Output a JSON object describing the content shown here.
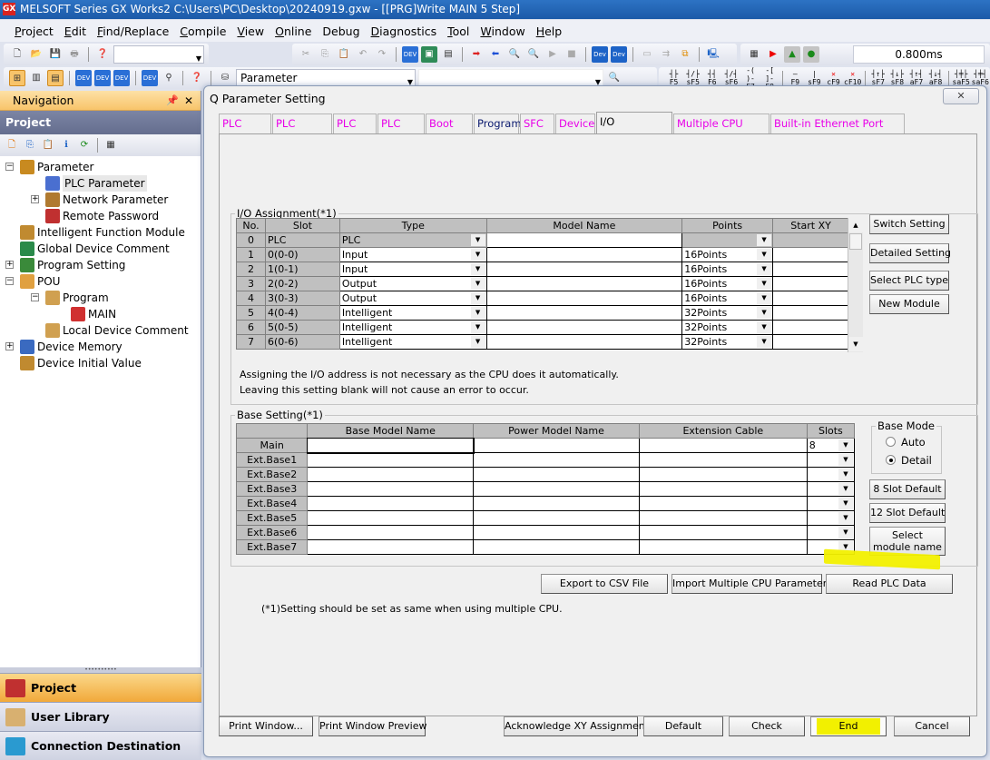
{
  "window": {
    "title": "MELSOFT Series GX Works2 C:\\Users\\PC\\Desktop\\20240919.gxw - [[PRG]Write MAIN 5 Step]",
    "app_icon": "gx-works-icon"
  },
  "menu": [
    {
      "label": "Project",
      "u": "P",
      "rest": "roject"
    },
    {
      "label": "Edit",
      "u": "E",
      "rest": "dit"
    },
    {
      "label": "Find/Replace",
      "u": "F",
      "rest": "ind/Replace"
    },
    {
      "label": "Compile",
      "u": "C",
      "rest": "ompile"
    },
    {
      "label": "View",
      "u": "V",
      "rest": "iew"
    },
    {
      "label": "Online",
      "u": "O",
      "rest": "nline"
    },
    {
      "label": "Debug",
      "u": "",
      "rest": "Debug"
    },
    {
      "label": "Diagnostics",
      "u": "D",
      "rest": "iagnostics"
    },
    {
      "label": "Tool",
      "u": "T",
      "rest": "ool"
    },
    {
      "label": "Window",
      "u": "W",
      "rest": "indow"
    },
    {
      "label": "Help",
      "u": "H",
      "rest": "elp"
    }
  ],
  "toolbar": {
    "scan_time": "0.800ms",
    "navigation_combo": "Parameter",
    "ladder_tools": [
      {
        "sym": "┤├",
        "key": "F5"
      },
      {
        "sym": "┤/├",
        "key": "sF5"
      },
      {
        "sym": "┤┤",
        "key": "F6"
      },
      {
        "sym": "┤/┤",
        "key": "sF6"
      },
      {
        "sym": "-( )-",
        "key": "F7"
      },
      {
        "sym": "-[ ]-",
        "key": "F8"
      },
      {
        "sym": "—",
        "key": "F9"
      },
      {
        "sym": "|",
        "key": "sF9"
      },
      {
        "sym": "✕",
        "key": "cF9"
      },
      {
        "sym": "✕",
        "key": "cF10"
      },
      {
        "sym": "┤↑├",
        "key": "sF7"
      },
      {
        "sym": "┤↓├",
        "key": "sF8"
      },
      {
        "sym": "┤↑┤",
        "key": "aF7"
      },
      {
        "sym": "┤↓┤",
        "key": "aF8"
      },
      {
        "sym": "┤╪├",
        "key": "saF5"
      },
      {
        "sym": "┤╪┤",
        "key": "saF6"
      }
    ]
  },
  "navigation": {
    "title": "Navigation",
    "section": "Project",
    "tree": [
      {
        "label": "Parameter",
        "level": 0,
        "expander": "-",
        "icon": "parameter-icon"
      },
      {
        "label": "PLC Parameter",
        "level": 1,
        "expander": "",
        "icon": "plc-parameter-icon",
        "selected": true
      },
      {
        "label": "Network Parameter",
        "level": 1,
        "expander": "+",
        "icon": "network-parameter-icon"
      },
      {
        "label": "Remote Password",
        "level": 1,
        "expander": "",
        "icon": "remote-password-icon"
      },
      {
        "label": "Intelligent Function Module",
        "level": 0,
        "expander": "",
        "icon": "intelligent-module-icon"
      },
      {
        "label": "Global Device Comment",
        "level": 0,
        "expander": "",
        "icon": "global-comment-icon"
      },
      {
        "label": "Program Setting",
        "level": 0,
        "expander": "+",
        "icon": "program-setting-icon"
      },
      {
        "label": "POU",
        "level": 0,
        "expander": "-",
        "icon": "pou-icon"
      },
      {
        "label": "Program",
        "level": 1,
        "expander": "-",
        "icon": "program-folder-icon"
      },
      {
        "label": "MAIN",
        "level": 2,
        "expander": "",
        "icon": "ladder-program-icon"
      },
      {
        "label": "Local Device Comment",
        "level": 1,
        "expander": "",
        "icon": "local-comment-icon"
      },
      {
        "label": "Device Memory",
        "level": 0,
        "expander": "+",
        "icon": "device-memory-icon"
      },
      {
        "label": "Device Initial Value",
        "level": 0,
        "expander": "",
        "icon": "device-initial-icon"
      }
    ],
    "bottom_tabs": [
      {
        "label": "Project",
        "active": true
      },
      {
        "label": "User Library",
        "active": false
      },
      {
        "label": "Connection Destination",
        "active": false
      }
    ]
  },
  "dialog": {
    "title": "Q Parameter Setting",
    "tabs": [
      {
        "label": "PLC Name",
        "style": "pink"
      },
      {
        "label": "PLC System",
        "style": "pink"
      },
      {
        "label": "PLC File",
        "style": "pink"
      },
      {
        "label": "PLC RAS",
        "style": "pink"
      },
      {
        "label": "Boot File",
        "style": "pink"
      },
      {
        "label": "Program",
        "style": "dark"
      },
      {
        "label": "SFC",
        "style": "pink"
      },
      {
        "label": "Device",
        "style": "pink"
      },
      {
        "label": "I/O Assignment",
        "style": "active"
      },
      {
        "label": "Multiple CPU Setting",
        "style": "pink"
      },
      {
        "label": "Built-in Ethernet Port Setting",
        "style": "pink"
      }
    ],
    "io": {
      "legend": "I/O Assignment(*1)",
      "columns": [
        "No.",
        "Slot",
        "Type",
        "Model Name",
        "Points",
        "Start XY"
      ],
      "rows": [
        {
          "no": "0",
          "slot": "PLC",
          "type": "PLC",
          "model": "",
          "points": "",
          "start": ""
        },
        {
          "no": "1",
          "slot": "0(0-0)",
          "type": "Input",
          "model": "",
          "points": "16Points",
          "start": ""
        },
        {
          "no": "2",
          "slot": "1(0-1)",
          "type": "Input",
          "model": "",
          "points": "16Points",
          "start": ""
        },
        {
          "no": "3",
          "slot": "2(0-2)",
          "type": "Output",
          "model": "",
          "points": "16Points",
          "start": ""
        },
        {
          "no": "4",
          "slot": "3(0-3)",
          "type": "Output",
          "model": "",
          "points": "16Points",
          "start": ""
        },
        {
          "no": "5",
          "slot": "4(0-4)",
          "type": "Intelligent",
          "model": "",
          "points": "32Points",
          "start": ""
        },
        {
          "no": "6",
          "slot": "5(0-5)",
          "type": "Intelligent",
          "model": "",
          "points": "32Points",
          "start": ""
        },
        {
          "no": "7",
          "slot": "6(0-6)",
          "type": "Intelligent",
          "model": "",
          "points": "32Points",
          "start": ""
        }
      ],
      "buttons": [
        "Switch Setting",
        "Detailed Setting",
        "Select PLC type",
        "New Module"
      ],
      "note1": "Assigning the I/O address is not necessary as the CPU does it automatically.",
      "note2": "Leaving this setting blank will not cause an error to occur."
    },
    "base": {
      "legend": "Base Setting(*1)",
      "columns": [
        "",
        "Base Model Name",
        "Power Model Name",
        "Extension Cable",
        "Slots"
      ],
      "rows": [
        {
          "name": "Main",
          "slots": "8"
        },
        {
          "name": "Ext.Base1",
          "slots": ""
        },
        {
          "name": "Ext.Base2",
          "slots": ""
        },
        {
          "name": "Ext.Base3",
          "slots": ""
        },
        {
          "name": "Ext.Base4",
          "slots": ""
        },
        {
          "name": "Ext.Base5",
          "slots": ""
        },
        {
          "name": "Ext.Base6",
          "slots": ""
        },
        {
          "name": "Ext.Base7",
          "slots": ""
        }
      ],
      "mode_legend": "Base Mode",
      "mode_options": [
        {
          "label": "Auto",
          "checked": false
        },
        {
          "label": "Detail",
          "checked": true
        }
      ],
      "buttons": [
        "8 Slot Default",
        "12 Slot Default",
        "Select\nmodule name"
      ]
    },
    "actions": {
      "export_csv": "Export to CSV File",
      "import_multi": "Import Multiple CPU Parameter",
      "read_plc": "Read PLC Data"
    },
    "footnote": "(*1)Setting should be set as same when using multiple CPU.",
    "footer": {
      "print_window": "Print Window...",
      "print_preview": "Print Window Preview",
      "ack_xy": "Acknowledge XY Assignment",
      "default": "Default",
      "check": "Check",
      "end": "End",
      "cancel": "Cancel"
    },
    "close_glyph": "✕"
  },
  "colors": {
    "highlight": "#f2f000",
    "tab_pink": "#e800e8",
    "nav_active": "#f1a93a"
  }
}
